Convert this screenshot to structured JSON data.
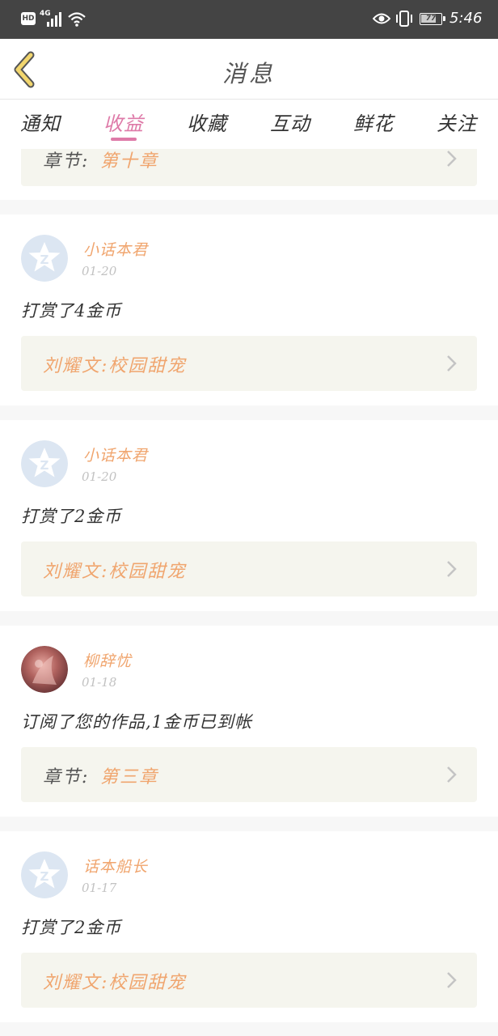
{
  "status_bar": {
    "hd": "HD",
    "network": "4G",
    "battery_level": "77",
    "battery_fraction": 0.77,
    "time": "5:46"
  },
  "header": {
    "title": "消息",
    "back_icon": "chevron-left-icon"
  },
  "tabs": [
    {
      "label": "通知",
      "active": false
    },
    {
      "label": "收益",
      "active": true
    },
    {
      "label": "收藏",
      "active": false
    },
    {
      "label": "互动",
      "active": false
    },
    {
      "label": "鲜花",
      "active": false
    },
    {
      "label": "关注",
      "active": false
    }
  ],
  "colors": {
    "accent": "#de7aa8",
    "highlight": "#f0a56e",
    "status_bar": "#444444"
  },
  "items": [
    {
      "link_label": "章节:",
      "link_value": "第十章"
    },
    {
      "user": "小话本君",
      "date": "01-20",
      "message": "打赏了4金币",
      "avatar": "default-star-avatar",
      "link_value": "刘耀文:校园甜宠"
    },
    {
      "user": "小话本君",
      "date": "01-20",
      "message": "打赏了2金币",
      "avatar": "default-star-avatar",
      "link_value": "刘耀文:校园甜宠"
    },
    {
      "user": "柳辞忧",
      "date": "01-18",
      "message": "订阅了您的作品,1金币已到帐",
      "avatar": "photo-avatar",
      "link_label": "章节:",
      "link_value": "第三章"
    },
    {
      "user": "话本船长",
      "date": "01-17",
      "message": "打赏了2金币",
      "avatar": "default-star-avatar",
      "link_value": "刘耀文:校园甜宠"
    }
  ]
}
